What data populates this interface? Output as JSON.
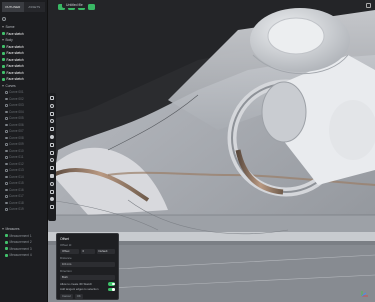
{
  "sidebar": {
    "tabs": [
      {
        "label": "OUTLINER",
        "active": true
      },
      {
        "label": "ASSETS",
        "active": false
      }
    ],
    "tree": [
      {
        "label": "Scene",
        "kind": "group"
      },
      {
        "label": "Face sketch",
        "kind": "sel"
      },
      {
        "label": "Body",
        "kind": "group"
      },
      {
        "label": "Face sketch",
        "kind": "sel"
      },
      {
        "label": "Face sketch",
        "kind": "sel"
      },
      {
        "label": "Face sketch",
        "kind": "sel"
      },
      {
        "label": "Face sketch",
        "kind": "sel"
      },
      {
        "label": "Face sketch",
        "kind": "sel"
      },
      {
        "label": "Face sketch",
        "kind": "sel"
      },
      {
        "label": "Curves",
        "kind": "group"
      },
      {
        "label": "Curve 001",
        "kind": "dim"
      },
      {
        "label": "Curve 002",
        "kind": "dim"
      },
      {
        "label": "Curve 003",
        "kind": "dim"
      },
      {
        "label": "Curve 004",
        "kind": "dim"
      },
      {
        "label": "Curve 005",
        "kind": "dim"
      },
      {
        "label": "Curve 006",
        "kind": "dim"
      },
      {
        "label": "Curve 007",
        "kind": "dim"
      },
      {
        "label": "Curve 008",
        "kind": "dim"
      },
      {
        "label": "Curve 009",
        "kind": "dim"
      },
      {
        "label": "Curve 010",
        "kind": "dim"
      },
      {
        "label": "Curve 011",
        "kind": "dim"
      },
      {
        "label": "Curve 012",
        "kind": "dim"
      },
      {
        "label": "Curve 013",
        "kind": "dim"
      },
      {
        "label": "Curve 014",
        "kind": "dim"
      },
      {
        "label": "Curve 015",
        "kind": "dim"
      },
      {
        "label": "Curve 016",
        "kind": "dim"
      },
      {
        "label": "Curve 017",
        "kind": "dim"
      },
      {
        "label": "Curve 018",
        "kind": "dim"
      },
      {
        "label": "Curve 019",
        "kind": "dim"
      }
    ],
    "bottom": [
      {
        "label": "Measures",
        "kind": "group"
      },
      {
        "label": "Measurement 1",
        "kind": "sub"
      },
      {
        "label": "Measurement 2",
        "kind": "sub"
      },
      {
        "label": "Measurement 3",
        "kind": "sub"
      },
      {
        "label": "Measurement 4",
        "kind": "sub"
      }
    ]
  },
  "topbar": {
    "doc_label": "Untitled file"
  },
  "props": {
    "title": "Offset",
    "label_1": "Offset Id",
    "field_1a": "Offset",
    "field_1b": "0",
    "field_1c": "Default",
    "label_2": "Distance",
    "field_2": "0.0 mm",
    "label_3": "Direction",
    "field_3": "Both",
    "toggle_1": "Allow to create 3D Sketch",
    "toggle_2": "Add tangent edges to selection",
    "footer_btn_1": "Cancel",
    "footer_btn_2": "OK"
  },
  "colors": {
    "accent_green": "#42c06b",
    "viewport_bg": "#2a2b2e",
    "sidebar_bg": "#1c1d20"
  }
}
